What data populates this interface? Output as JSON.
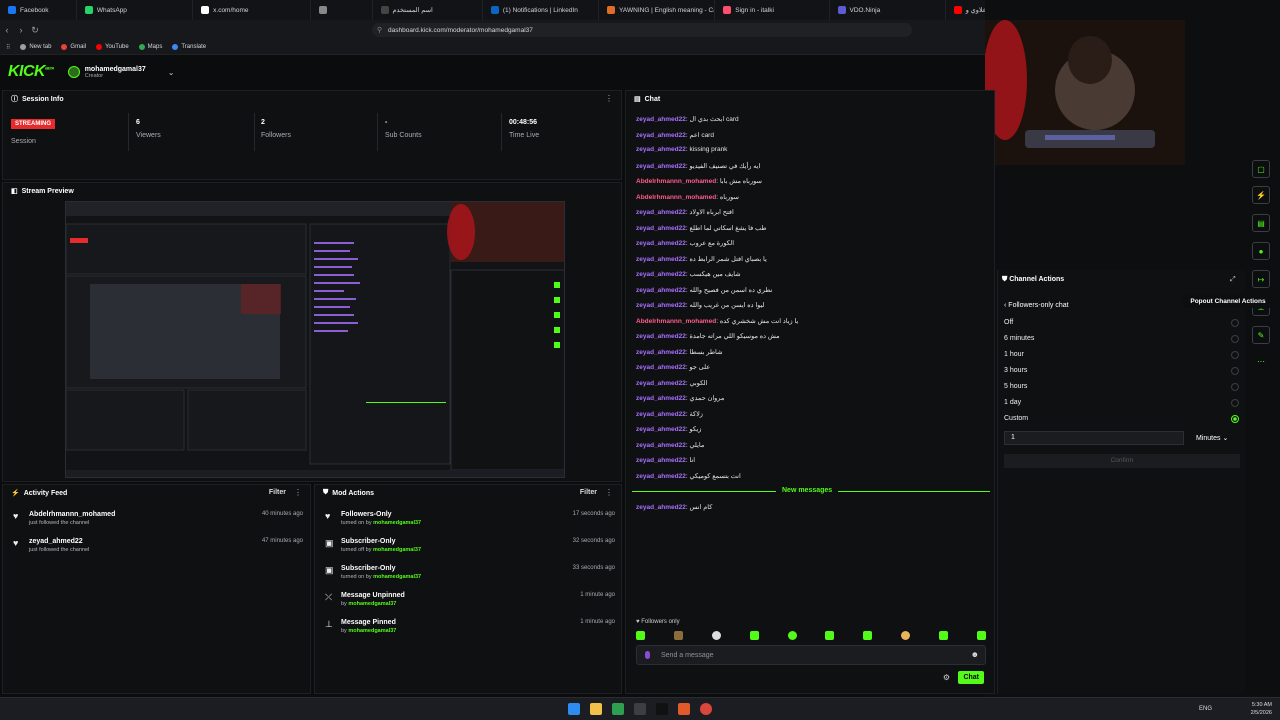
{
  "browser": {
    "tabs": [
      {
        "label": "Facebook",
        "color": "#1877f2"
      },
      {
        "label": "WhatsApp",
        "color": "#25d366"
      },
      {
        "label": "x.com/home",
        "color": "#ffffff"
      },
      {
        "label": "",
        "color": "#888888"
      },
      {
        "label": "اسم المستخدم",
        "color": "#444444"
      },
      {
        "label": "(1) Notifications | LinkedIn",
        "color": "#0a66c2"
      },
      {
        "label": "YAWNING | English meaning - Cam",
        "color": "#e06c2b"
      },
      {
        "label": "Sign in - italki",
        "color": "#ff4d6d"
      },
      {
        "label": "VDO.Ninja",
        "color": "#5b5bd6"
      },
      {
        "label": "علاوي و",
        "color": "#ff0000"
      }
    ],
    "url": "dashboard.kick.com/moderator/mohamedgamal37",
    "bookmarks": [
      {
        "label": "New tab",
        "color": "#9aa0a6"
      },
      {
        "label": "Gmail",
        "color": "#ea4335"
      },
      {
        "label": "YouTube",
        "color": "#ff0000"
      },
      {
        "label": "Maps",
        "color": "#34a853"
      },
      {
        "label": "Translate",
        "color": "#4285f4"
      }
    ]
  },
  "header": {
    "logo": "KICK",
    "logo_sup": "BETA",
    "username": "mohamedgamal37",
    "role": "Creator"
  },
  "session": {
    "title": "Session Info",
    "live_badge": "STREAMING",
    "session_label": "Session",
    "stats": [
      {
        "value": "6",
        "label": "Viewers"
      },
      {
        "value": "2",
        "label": "Followers"
      },
      {
        "value": "-",
        "label": "Sub Counts"
      },
      {
        "value": "00:48:56",
        "label": "Time Live"
      }
    ]
  },
  "preview": {
    "title": "Stream Preview"
  },
  "activity": {
    "title": "Activity Feed",
    "filter": "Filter",
    "items": [
      {
        "name": "Abdelrhmannn_mohamed",
        "sub": "just followed the channel",
        "time": "40 minutes ago"
      },
      {
        "name": "zeyad_ahmed22",
        "sub": "just followed the channel",
        "time": "47 minutes ago"
      }
    ]
  },
  "mod_actions": {
    "title": "Mod Actions",
    "filter": "Filter",
    "items": [
      {
        "name": "Followers-Only",
        "prefix": "turned on by",
        "by": "mohamedgamal37",
        "time": "17 seconds ago",
        "icon": "heart-icon",
        "glyph": "♥"
      },
      {
        "name": "Subscriber-Only",
        "prefix": "turned off by",
        "by": "mohamedgamal37",
        "time": "32 seconds ago",
        "icon": "gift-icon",
        "glyph": "▣"
      },
      {
        "name": "Subscriber-Only",
        "prefix": "turned on by",
        "by": "mohamedgamal37",
        "time": "33 seconds ago",
        "icon": "gift-icon",
        "glyph": "▣"
      },
      {
        "name": "Message Unpinned",
        "prefix": "by",
        "by": "mohamedgamal37",
        "time": "1 minute ago",
        "icon": "unpin-icon",
        "glyph": "⤫"
      },
      {
        "name": "Message Pinned",
        "prefix": "by",
        "by": "mohamedgamal37",
        "time": "1 minute ago",
        "icon": "pin-icon",
        "glyph": "⊥"
      }
    ]
  },
  "chat": {
    "title": "Chat",
    "messages": [
      {
        "user": "zeyad_ahmed22",
        "text": "ابحث بدي ال card",
        "color": "#a970ff"
      },
      {
        "user": "zeyad_ahmed22",
        "text": "اعم card",
        "color": "#a970ff"
      },
      {
        "user": "zeyad_ahmed22",
        "text": "kissing prank",
        "color": "#a970ff"
      },
      {
        "user": "zeyad_ahmed22",
        "text": "ايه رأيك في تصنيف الفيديو",
        "color": "#a970ff"
      },
      {
        "user": "Abdelrhmannn_mohamed",
        "text": "سورباه مش بابا",
        "color": "#ff5c8a"
      },
      {
        "user": "Abdelrhmannn_mohamed",
        "text": "سورباه",
        "color": "#ff5c8a"
      },
      {
        "user": "zeyad_ahmed22",
        "text": "افتح ابرباه الاولاد",
        "color": "#a970ff"
      },
      {
        "user": "zeyad_ahmed22",
        "text": "طب فا يشغ اسكاتي لما اطلع",
        "color": "#a970ff"
      },
      {
        "user": "zeyad_ahmed22",
        "text": "الكورة مع عروب",
        "color": "#a970ff"
      },
      {
        "user": "zeyad_ahmed22",
        "text": "يا بصباي افتل شمر الرابط ده",
        "color": "#a970ff"
      },
      {
        "user": "zeyad_ahmed22",
        "text": "شايف مين هيكسب",
        "color": "#a970ff"
      },
      {
        "user": "zeyad_ahmed22",
        "text": "نطري ده اسمن من فصيح والله",
        "color": "#a970ff"
      },
      {
        "user": "zeyad_ahmed22",
        "text": "ليوا ده ايسن من غريب والله",
        "color": "#a970ff"
      },
      {
        "user": "Abdelrhmannn_mohamed",
        "text": "يا زياد انت مش شخشري كده",
        "color": "#ff5c8a"
      },
      {
        "user": "zeyad_ahmed22",
        "text": "مش ده موسيكو اللي مراته جامدة",
        "color": "#a970ff"
      },
      {
        "user": "zeyad_ahmed22",
        "text": "شاطر بسطا",
        "color": "#a970ff"
      },
      {
        "user": "zeyad_ahmed22",
        "text": "على جو",
        "color": "#a970ff"
      },
      {
        "user": "zeyad_ahmed22",
        "text": "الكوبي",
        "color": "#a970ff"
      },
      {
        "user": "zeyad_ahmed22",
        "text": "مروان حمدي",
        "color": "#a970ff"
      },
      {
        "user": "zeyad_ahmed22",
        "text": "زلاكة",
        "color": "#a970ff"
      },
      {
        "user": "zeyad_ahmed22",
        "text": "زيكو",
        "color": "#a970ff"
      },
      {
        "user": "zeyad_ahmed22",
        "text": "مايلي",
        "color": "#a970ff"
      },
      {
        "user": "zeyad_ahmed22",
        "text": "انا",
        "color": "#a970ff"
      },
      {
        "user": "zeyad_ahmed22",
        "text": "انت بتسمع كوميكي",
        "color": "#a970ff"
      }
    ],
    "new_messages_label": "New messages",
    "after_new": [
      {
        "user": "zeyad_ahmed22",
        "text": "كام انس",
        "color": "#a970ff"
      }
    ],
    "followers_only": "Followers only",
    "placeholder": "Send a message",
    "send_label": "Chat"
  },
  "channel_actions": {
    "title": "Channel Actions",
    "sub_title": "Followers-only chat",
    "tooltip": "Popout Channel Actions",
    "options": [
      {
        "label": "Off",
        "selected": false
      },
      {
        "label": "6 minutes",
        "selected": false
      },
      {
        "label": "1 hour",
        "selected": false
      },
      {
        "label": "3 hours",
        "selected": false
      },
      {
        "label": "5 hours",
        "selected": false
      },
      {
        "label": "1 day",
        "selected": false
      },
      {
        "label": "Custom",
        "selected": true
      }
    ],
    "custom_value": "1",
    "unit": "Minutes",
    "confirm": "Confirm"
  },
  "taskbar": {
    "lang": "ENG",
    "time": "5:30 AM",
    "date": "2/5/2026"
  },
  "colors": {
    "accent": "#53fc18",
    "live": "#e52b2b"
  }
}
